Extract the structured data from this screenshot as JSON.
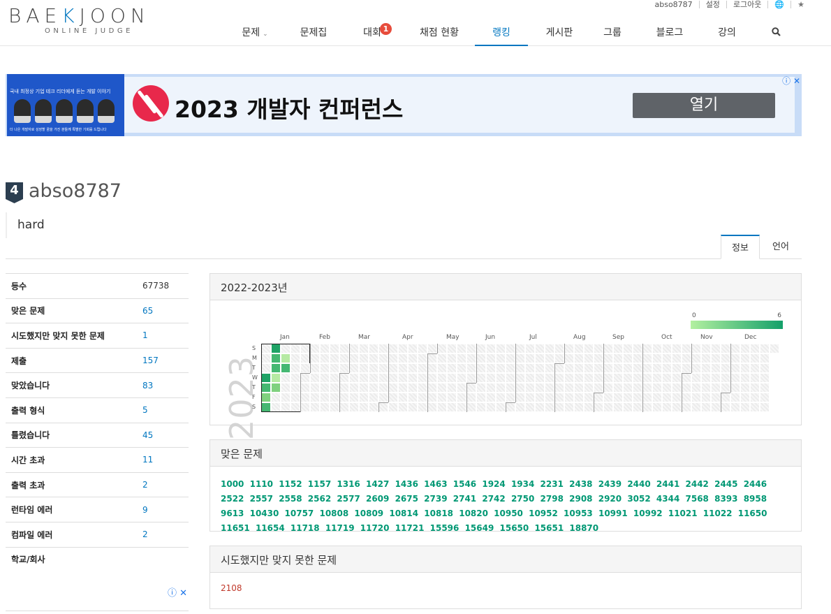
{
  "userbar": {
    "username": "abso8787",
    "settings": "설정",
    "logout": "로그아웃",
    "globe": "globe-icon",
    "star": "star-icon"
  },
  "logo": {
    "word_left": "BAE",
    "word_k": "K",
    "word_right": "JOON",
    "sub": "ONLINE JUDGE"
  },
  "nav": {
    "items": [
      {
        "label": "문제",
        "has_dropdown": true
      },
      {
        "label": "문제집"
      },
      {
        "label": "대회",
        "badge": "1"
      },
      {
        "label": "채점 현황"
      },
      {
        "label": "랭킹",
        "active": true
      },
      {
        "label": "게시판"
      },
      {
        "label": "그룹"
      },
      {
        "label": "블로그"
      },
      {
        "label": "강의"
      }
    ],
    "search_icon": "search-icon"
  },
  "ad": {
    "left_text": "국내 최정상 기업 테크 리더에게 듣는 개발 이야기",
    "left_bottom": "더 나은 개발자로 성장할 꿈을 가진 분들께 특별한 기회를 드립니다",
    "title": "2023 개발자 컨퍼런스",
    "button": "열기"
  },
  "profile": {
    "rank_tier": "4",
    "username": "abso8787",
    "status_message": "hard",
    "accent": "#0076c0"
  },
  "tabs": [
    {
      "label": "정보",
      "active": true
    },
    {
      "label": "언어"
    }
  ],
  "stats": [
    {
      "key": "등수",
      "value": "67738",
      "link": false
    },
    {
      "key": "맞은 문제",
      "value": "65",
      "link": true
    },
    {
      "key": "시도했지만 맞지 못한 문제",
      "value": "1",
      "link": true
    },
    {
      "key": "제출",
      "value": "157",
      "link": true
    },
    {
      "key": "맞았습니다",
      "value": "83",
      "link": true
    },
    {
      "key": "출력 형식",
      "value": "5",
      "link": true
    },
    {
      "key": "틀렸습니다",
      "value": "45",
      "link": true
    },
    {
      "key": "시간 초과",
      "value": "11",
      "link": true
    },
    {
      "key": "출력 초과",
      "value": "2",
      "link": true
    },
    {
      "key": "런타임 에러",
      "value": "9",
      "link": true
    },
    {
      "key": "컴파일 에러",
      "value": "2",
      "link": true
    },
    {
      "key": "학교/회사",
      "value": "",
      "link": false
    }
  ],
  "heatmap": {
    "title": "2022-2023년",
    "year": "2023",
    "legend_min": "0",
    "legend_max": "6",
    "weekdays": [
      "S",
      "M",
      "T",
      "W",
      "T",
      "F",
      "S"
    ],
    "months": [
      "Jan",
      "Feb",
      "Mar",
      "Apr",
      "May",
      "Jun",
      "Jul",
      "Aug",
      "Sep",
      "Oct",
      "Nov",
      "Dec"
    ],
    "active_cells": [
      {
        "week": 0,
        "day": 3,
        "level": 4
      },
      {
        "week": 0,
        "day": 4,
        "level": 3
      },
      {
        "week": 0,
        "day": 5,
        "level": 2
      },
      {
        "week": 0,
        "day": 6,
        "level": 3
      },
      {
        "week": 1,
        "day": 0,
        "level": 4
      },
      {
        "week": 1,
        "day": 1,
        "level": 3
      },
      {
        "week": 1,
        "day": 2,
        "level": 3
      },
      {
        "week": 1,
        "day": 3,
        "level": 1
      },
      {
        "week": 1,
        "day": 4,
        "level": 2
      },
      {
        "week": 2,
        "day": 1,
        "level": 1
      },
      {
        "week": 2,
        "day": 2,
        "level": 3
      }
    ]
  },
  "solved": {
    "title": "맞은 문제",
    "problems": [
      "1000",
      "1110",
      "1152",
      "1157",
      "1316",
      "1427",
      "1436",
      "1463",
      "1546",
      "1924",
      "1934",
      "2231",
      "2438",
      "2439",
      "2440",
      "2441",
      "2442",
      "2445",
      "2446",
      "2522",
      "2557",
      "2558",
      "2562",
      "2577",
      "2609",
      "2675",
      "2739",
      "2741",
      "2742",
      "2750",
      "2798",
      "2908",
      "2920",
      "3052",
      "4344",
      "7568",
      "8393",
      "8958",
      "9613",
      "10430",
      "10757",
      "10808",
      "10809",
      "10814",
      "10818",
      "10820",
      "10950",
      "10952",
      "10953",
      "10991",
      "10992",
      "11021",
      "11022",
      "11650",
      "11651",
      "11654",
      "11718",
      "11719",
      "11720",
      "11721",
      "15596",
      "15649",
      "15650",
      "15651",
      "18870"
    ]
  },
  "failed": {
    "title": "시도했지만 맞지 못한 문제",
    "problems": [
      "2108"
    ]
  }
}
